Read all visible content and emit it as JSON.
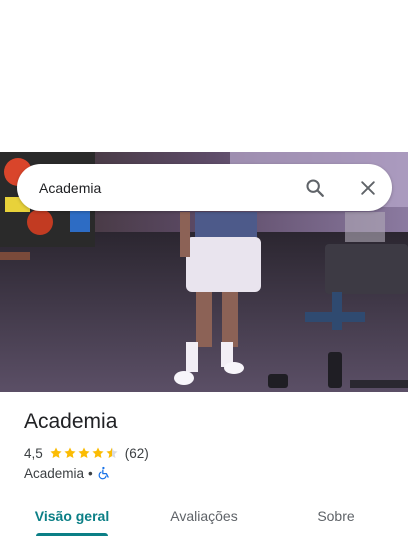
{
  "search": {
    "value": "Academia",
    "search_icon": "search-icon",
    "close_icon": "close-icon"
  },
  "place": {
    "name": "Academia",
    "rating": "4,5",
    "stars_filled": 4.5,
    "review_count": "(62)",
    "category": "Academia",
    "separator": "•",
    "accessibility_icon": "wheelchair-icon"
  },
  "tabs": [
    {
      "label": "Visão geral",
      "active": true
    },
    {
      "label": "Avaliações",
      "active": false
    },
    {
      "label": "Sobre",
      "active": false
    }
  ],
  "colors": {
    "accent": "#0b7f86",
    "star": "#fbbc04",
    "accessibility": "#1a73e8"
  }
}
